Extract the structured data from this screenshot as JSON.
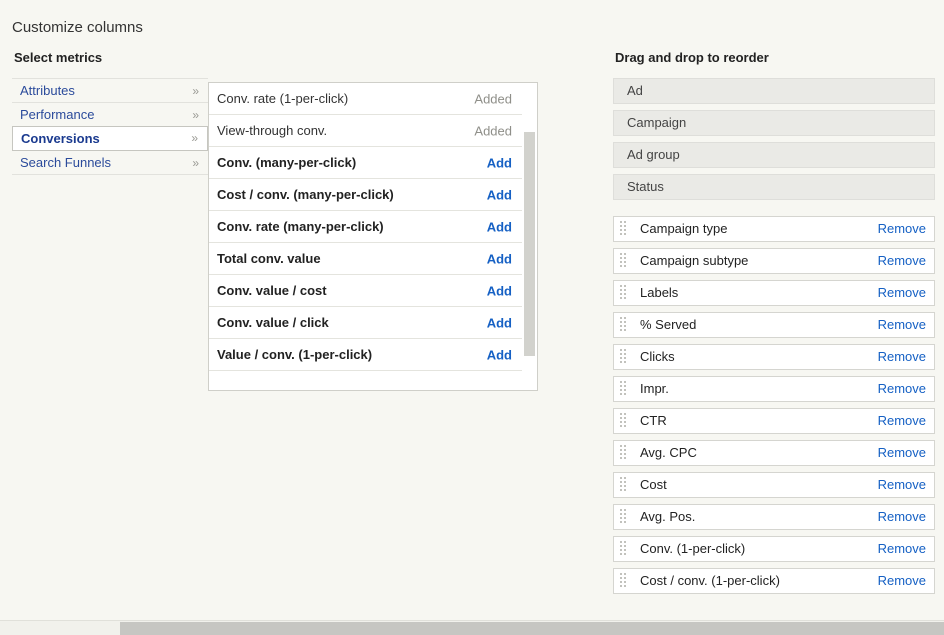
{
  "page": {
    "title": "Customize columns"
  },
  "left": {
    "heading": "Select metrics",
    "categories": [
      {
        "label": "Attributes",
        "chevron": "»",
        "selected": false
      },
      {
        "label": "Performance",
        "chevron": "»",
        "selected": false
      },
      {
        "label": "Conversions",
        "chevron": "»",
        "selected": true
      },
      {
        "label": "Search Funnels",
        "chevron": "»",
        "selected": false
      }
    ]
  },
  "metrics": {
    "added_label": "Added",
    "add_label": "Add",
    "rows": [
      {
        "name": "Conv. rate (1-per-click)",
        "action": "Added",
        "state": "added"
      },
      {
        "name": "View-through conv.",
        "action": "Added",
        "state": "added"
      },
      {
        "name": "Conv. (many-per-click)",
        "action": "Add",
        "state": "available"
      },
      {
        "name": "Cost / conv. (many-per-click)",
        "action": "Add",
        "state": "available"
      },
      {
        "name": "Conv. rate (many-per-click)",
        "action": "Add",
        "state": "available"
      },
      {
        "name": "Total conv. value",
        "action": "Add",
        "state": "available"
      },
      {
        "name": "Conv. value / cost",
        "action": "Add",
        "state": "available"
      },
      {
        "name": "Conv. value / click",
        "action": "Add",
        "state": "available"
      },
      {
        "name": "Value / conv. (1-per-click)",
        "action": "Add",
        "state": "available"
      }
    ]
  },
  "right": {
    "heading": "Drag and drop to reorder",
    "remove_label": "Remove",
    "locked_items": [
      {
        "label": "Ad"
      },
      {
        "label": "Campaign"
      },
      {
        "label": "Ad group"
      },
      {
        "label": "Status"
      }
    ],
    "draggable_items": [
      {
        "label": "Campaign type",
        "remove": "Remove"
      },
      {
        "label": "Campaign subtype",
        "remove": "Remove"
      },
      {
        "label": "Labels",
        "remove": "Remove"
      },
      {
        "label": "% Served",
        "remove": "Remove"
      },
      {
        "label": "Clicks",
        "remove": "Remove"
      },
      {
        "label": "Impr.",
        "remove": "Remove"
      },
      {
        "label": "CTR",
        "remove": "Remove"
      },
      {
        "label": "Avg. CPC",
        "remove": "Remove"
      },
      {
        "label": "Cost",
        "remove": "Remove"
      },
      {
        "label": "Avg. Pos.",
        "remove": "Remove"
      },
      {
        "label": "Conv. (1-per-click)",
        "remove": "Remove"
      },
      {
        "label": "Cost / conv. (1-per-click)",
        "remove": "Remove"
      }
    ]
  },
  "colors": {
    "link": "#1560c4",
    "category_link": "#2b4b9b",
    "muted": "#8f8f89",
    "page_background": "#f7f7f2",
    "locked_background": "#eaeae6"
  }
}
